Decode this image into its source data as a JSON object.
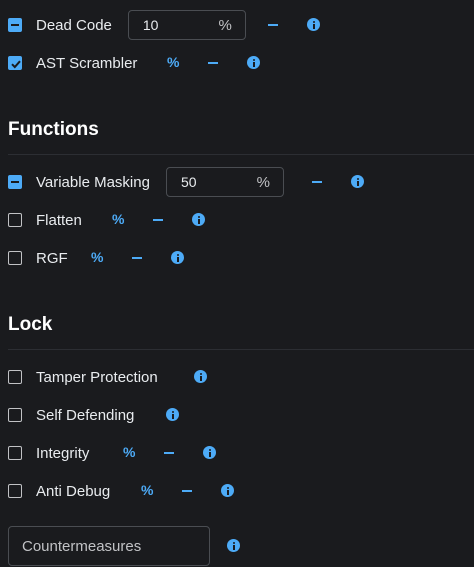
{
  "top_options": [
    {
      "label": "Dead Code",
      "state": "indeterminate",
      "value": "10",
      "unit": "%"
    },
    {
      "label": "AST Scrambler",
      "state": "checked",
      "unit": "%"
    }
  ],
  "functions": {
    "title": "Functions",
    "options": [
      {
        "label": "Variable Masking",
        "state": "indeterminate",
        "value": "50",
        "unit": "%"
      },
      {
        "label": "Flatten",
        "state": "unchecked",
        "unit": "%"
      },
      {
        "label": "RGF",
        "state": "unchecked",
        "unit": "%"
      }
    ]
  },
  "lock": {
    "title": "Lock",
    "options": [
      {
        "label": "Tamper Protection",
        "state": "unchecked"
      },
      {
        "label": "Self Defending",
        "state": "unchecked"
      },
      {
        "label": "Integrity",
        "state": "unchecked",
        "unit": "%"
      },
      {
        "label": "Anti Debug",
        "state": "unchecked",
        "unit": "%"
      }
    ],
    "countermeasures": {
      "placeholder": "Countermeasures"
    }
  },
  "colors": {
    "accent": "#4dabf7",
    "background": "#1a1b1e",
    "text": "#e9ecef"
  },
  "icons": {
    "info": "info-circle-icon",
    "dash": "minus-icon"
  }
}
